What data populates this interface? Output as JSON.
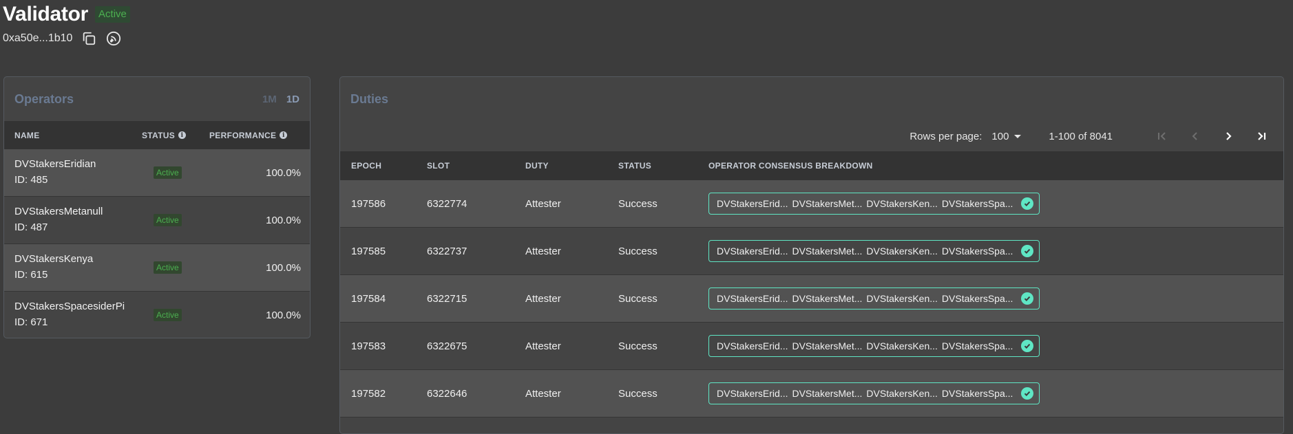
{
  "header": {
    "title": "Validator",
    "status": "Active",
    "address": "0xa50e...1b10"
  },
  "operators": {
    "title": "Operators",
    "ranges": [
      "1M",
      "1D"
    ],
    "selected_range": "1D",
    "columns": [
      "NAME",
      "STATUS",
      "PERFORMANCE"
    ],
    "rows": [
      {
        "name": "DVStakersEridian",
        "id": "ID: 485",
        "status": "Active",
        "performance": "100.0%"
      },
      {
        "name": "DVStakersMetanull",
        "id": "ID: 487",
        "status": "Active",
        "performance": "100.0%"
      },
      {
        "name": "DVStakersKenya",
        "id": "ID: 615",
        "status": "Active",
        "performance": "100.0%"
      },
      {
        "name": "DVStakersSpacesiderPi",
        "id": "ID: 671",
        "status": "Active",
        "performance": "100.0%"
      }
    ]
  },
  "duties": {
    "title": "Duties",
    "pager": {
      "rows_per_page_label": "Rows per page:",
      "rows_per_page": "100",
      "range": "1-100 of 8041"
    },
    "columns": [
      "EPOCH",
      "SLOT",
      "DUTY",
      "STATUS",
      "OPERATOR CONSENSUS BREAKDOWN"
    ],
    "rows": [
      {
        "epoch": "197586",
        "slot": "6322774",
        "duty": "Attester",
        "status": "Success",
        "operators": [
          "DVStakersErid...",
          "DVStakersMet...",
          "DVStakersKen...",
          "DVStakersSpa..."
        ]
      },
      {
        "epoch": "197585",
        "slot": "6322737",
        "duty": "Attester",
        "status": "Success",
        "operators": [
          "DVStakersErid...",
          "DVStakersMet...",
          "DVStakersKen...",
          "DVStakersSpa..."
        ]
      },
      {
        "epoch": "197584",
        "slot": "6322715",
        "duty": "Attester",
        "status": "Success",
        "operators": [
          "DVStakersErid...",
          "DVStakersMet...",
          "DVStakersKen...",
          "DVStakersSpa..."
        ]
      },
      {
        "epoch": "197583",
        "slot": "6322675",
        "duty": "Attester",
        "status": "Success",
        "operators": [
          "DVStakersErid...",
          "DVStakersMet...",
          "DVStakersKen...",
          "DVStakersSpa..."
        ]
      },
      {
        "epoch": "197582",
        "slot": "6322646",
        "duty": "Attester",
        "status": "Success",
        "operators": [
          "DVStakersErid...",
          "DVStakersMet...",
          "DVStakersKen...",
          "DVStakersSpa..."
        ]
      }
    ]
  },
  "colors": {
    "accent": "#5fe6c4",
    "active_green": "#4caf50",
    "panel_title": "#6a7a92"
  },
  "icons": [
    "copy-icon",
    "explorer-link-icon",
    "info-icon",
    "chevron-down-icon",
    "first-page-icon",
    "prev-page-icon",
    "next-page-icon",
    "last-page-icon",
    "check-circle-icon"
  ]
}
